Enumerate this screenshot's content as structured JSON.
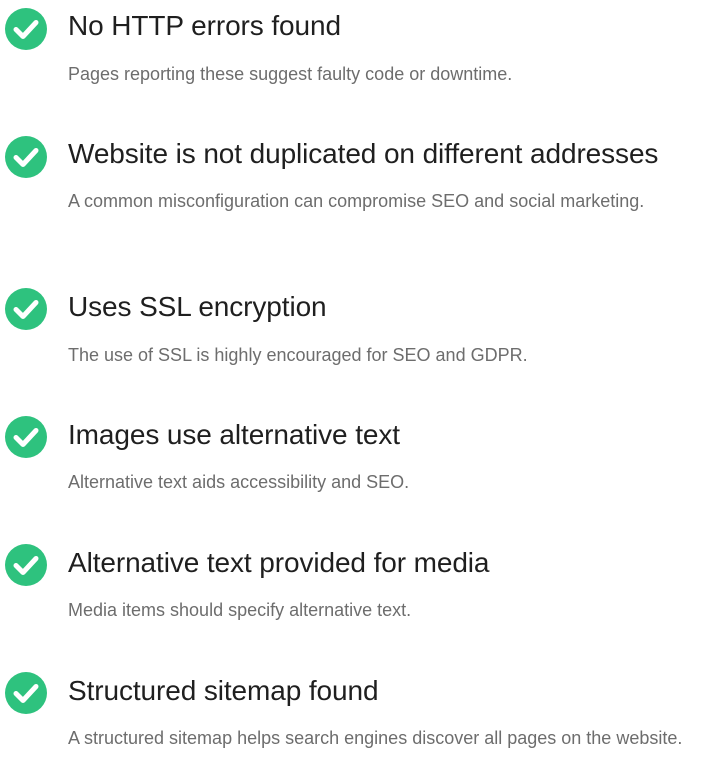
{
  "colors": {
    "accent": "#2ec27e",
    "title_text": "#1f1f1f",
    "description_text": "#6d6d6d"
  },
  "checks": [
    {
      "icon": "check-circle-icon",
      "status": "passed",
      "title": "No HTTP errors found",
      "description": "Pages reporting these suggest faulty code or downtime."
    },
    {
      "icon": "check-circle-icon",
      "status": "passed",
      "title": "Website is not duplicated on different addresses",
      "description": "A common misconfiguration can compromise SEO and social marketing."
    },
    {
      "icon": "check-circle-icon",
      "status": "passed",
      "title": "Uses SSL encryption",
      "description": "The use of SSL is highly encouraged for SEO and GDPR."
    },
    {
      "icon": "check-circle-icon",
      "status": "passed",
      "title": "Images use alternative text",
      "description": "Alternative text aids accessibility and SEO."
    },
    {
      "icon": "check-circle-icon",
      "status": "passed",
      "title": "Alternative text provided for media",
      "description": "Media items should specify alternative text."
    },
    {
      "icon": "check-circle-icon",
      "status": "passed",
      "title": "Structured sitemap found",
      "description": "A structured sitemap helps search engines discover all pages on the website."
    }
  ]
}
